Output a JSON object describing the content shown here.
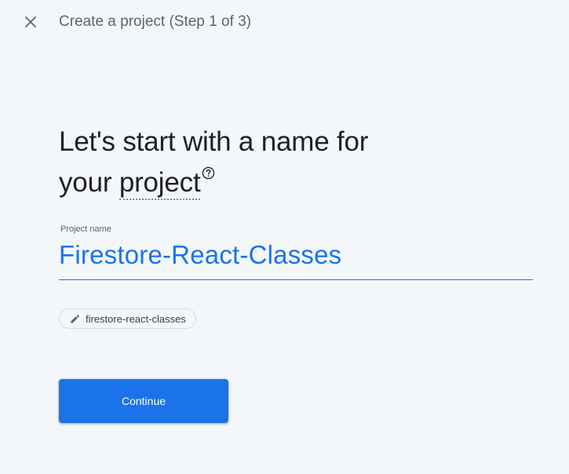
{
  "header": {
    "step_title": "Create a project (Step 1 of 3)",
    "close_icon": "close-icon"
  },
  "main": {
    "heading_line1": "Let's start with a name for",
    "heading_line2_prefix": "your ",
    "heading_term": "project",
    "help_icon": "help-icon"
  },
  "project_name": {
    "label": "Project name",
    "value": "Firestore-React-Classes"
  },
  "project_id_chip": {
    "icon": "edit-icon",
    "text": "firestore-react-classes"
  },
  "actions": {
    "continue_label": "Continue"
  },
  "colors": {
    "accent": "#1a73e8",
    "background": "#f4f7fa",
    "text_primary": "#202124",
    "text_secondary": "#5f6368"
  }
}
